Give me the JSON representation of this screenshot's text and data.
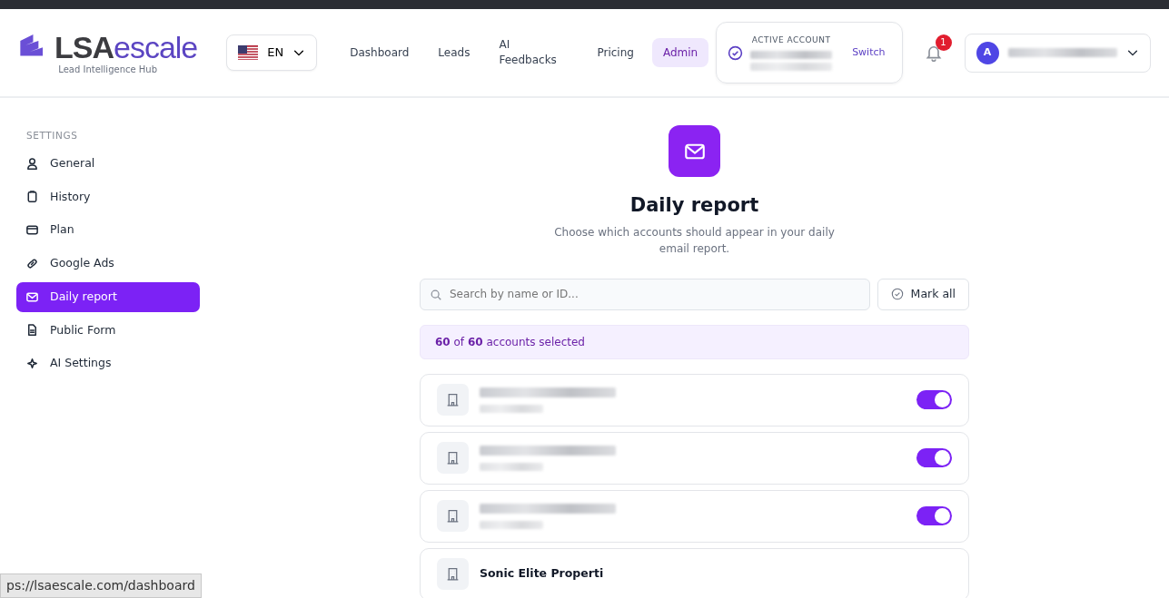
{
  "header": {
    "logo": {
      "part_1": "LSA",
      "part_2": "escale",
      "tagline": "Lead Intelligence Hub"
    },
    "language": {
      "code": "EN"
    },
    "nav": [
      {
        "label": "Dashboard",
        "selected": false
      },
      {
        "label": "Leads",
        "selected": false
      },
      {
        "label": "AI Feedbacks",
        "selected": false
      },
      {
        "label": "Pricing",
        "selected": false
      },
      {
        "label": "Admin",
        "selected": true
      }
    ],
    "active_account": {
      "label": "ACTIVE ACCOUNT",
      "action": "Switch"
    },
    "notifications": {
      "count": "1"
    },
    "user": {
      "initial": "A"
    }
  },
  "sidebar": {
    "heading": "SETTINGS",
    "items": [
      {
        "label": "General",
        "selected": false
      },
      {
        "label": "History",
        "selected": false
      },
      {
        "label": "Plan",
        "selected": false
      },
      {
        "label": "Google Ads",
        "selected": false
      },
      {
        "label": "Daily report",
        "selected": true
      },
      {
        "label": "Public Form",
        "selected": false
      },
      {
        "label": "AI Settings",
        "selected": false
      }
    ]
  },
  "main": {
    "title": "Daily report",
    "subtitle": "Choose which accounts should appear in your daily email report.",
    "search": {
      "placeholder": "Search by name or ID..."
    },
    "mark_all": "Mark all",
    "summary": "**60** of **60** accounts selected",
    "accounts": [
      {
        "on": true
      },
      {
        "on": true
      },
      {
        "on": true
      },
      {
        "name": "Sonic Elite Properti"
      }
    ]
  },
  "status_url": "ps://lsaescale.com/dashboard"
}
